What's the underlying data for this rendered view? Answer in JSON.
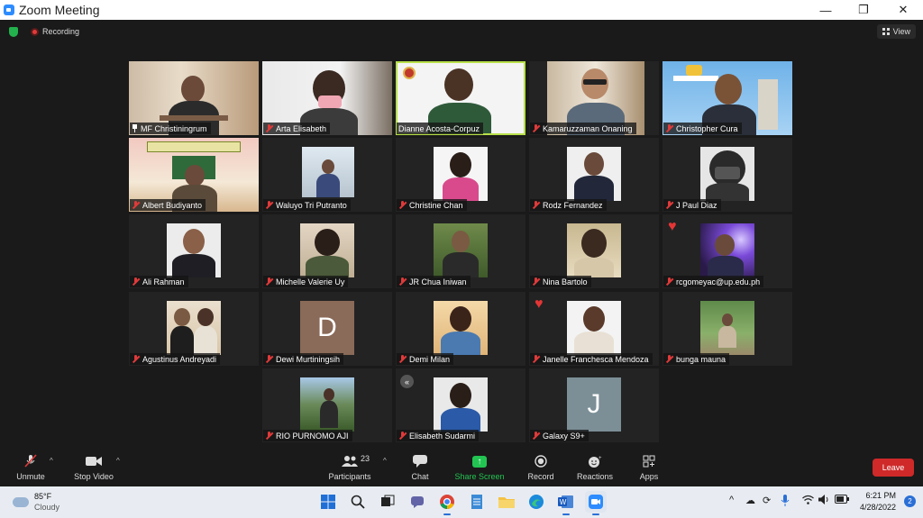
{
  "window": {
    "title": "Zoom Meeting",
    "minimize": "—",
    "restore": "❐",
    "close": "✕"
  },
  "meeting": {
    "recording_label": "Recording",
    "view_label": "View"
  },
  "participants": [
    {
      "name": "MF Christiningrum",
      "muted": false,
      "pinned": true
    },
    {
      "name": "Arta Elisabeth",
      "muted": true
    },
    {
      "name": "Dianne Acosta-Corpuz",
      "muted": false,
      "active_speaker": true
    },
    {
      "name": "Kamaruzzaman Onaning",
      "muted": true
    },
    {
      "name": "Christopher Cura",
      "muted": true
    },
    {
      "name": "Albert Budiyanto",
      "muted": true
    },
    {
      "name": "Waluyo Tri Putranto",
      "muted": true
    },
    {
      "name": "Christine Chan",
      "muted": true
    },
    {
      "name": "Rodz Fernandez",
      "muted": true
    },
    {
      "name": "J Paul Diaz",
      "muted": true
    },
    {
      "name": "Ali Rahman",
      "muted": true
    },
    {
      "name": "Michelle Valerie Uy",
      "muted": true
    },
    {
      "name": "JR Chua Iniwan",
      "muted": true
    },
    {
      "name": "Nina Bartolo",
      "muted": true
    },
    {
      "name": "rcgomeyac@up.edu.ph",
      "muted": true,
      "reaction": "heart"
    },
    {
      "name": "Agustinus Andreyadi",
      "muted": true
    },
    {
      "name": "Dewi Murtiningsih",
      "muted": true,
      "avatar_letter": "D",
      "avatar_color": "#8a6a58"
    },
    {
      "name": "Demi Milan",
      "muted": true
    },
    {
      "name": "Janelle Franchesca Mendoza",
      "muted": true,
      "reaction": "heart"
    },
    {
      "name": "bunga mauna",
      "muted": true
    },
    {
      "name": "RIO PURNOMO AJI",
      "muted": true
    },
    {
      "name": "Elisabeth Sudarmi",
      "muted": true
    },
    {
      "name": "Galaxy S9+",
      "muted": true,
      "avatar_letter": "J",
      "avatar_color": "#7c8f97"
    }
  ],
  "collapse_icon": "«",
  "controls": {
    "unmute": "Unmute",
    "stop_video": "Stop Video",
    "participants": "Participants",
    "participants_count": "23",
    "chat": "Chat",
    "share_screen": "Share Screen",
    "record": "Record",
    "reactions": "Reactions",
    "apps": "Apps",
    "leave": "Leave"
  },
  "taskbar": {
    "temperature": "85°F",
    "condition": "Cloudy",
    "time": "6:21 PM",
    "date": "4/28/2022",
    "notifications": "2"
  },
  "colors": {
    "accent_green": "#23c552",
    "leave_red": "#cf2929",
    "muted_red": "#e03a3a",
    "active_speaker_border": "#b8e04a"
  }
}
